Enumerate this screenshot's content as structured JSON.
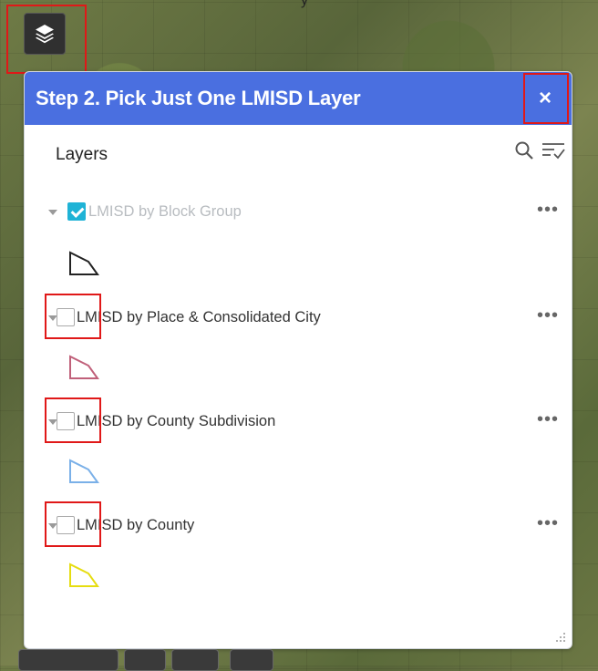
{
  "map": {
    "top_text": "y"
  },
  "panel": {
    "title": "Step 2. Pick Just One LMISD Layer",
    "close_label": "×",
    "layers_heading": "Layers",
    "more_label": "•••"
  },
  "layers": [
    {
      "label": "LMISD by Block Group",
      "checked": true,
      "dimmed": true,
      "swatch_color": "#222222"
    },
    {
      "label": "LMISD by Place & Consolidated City",
      "checked": false,
      "dimmed": false,
      "swatch_color": "#c0607a"
    },
    {
      "label": "LMISD by County Subdivision",
      "checked": false,
      "dimmed": false,
      "swatch_color": "#7ab0e8"
    },
    {
      "label": "LMISD by County",
      "checked": false,
      "dimmed": false,
      "swatch_color": "#f2ef1a"
    }
  ],
  "colors": {
    "header": "#4a6fe0",
    "checked": "#1fb3d6",
    "highlight": "#e01818"
  },
  "icons": {
    "layers_button": "layers-stack-icon",
    "search": "search-icon",
    "filter": "filter-list-icon",
    "close": "close-icon"
  }
}
